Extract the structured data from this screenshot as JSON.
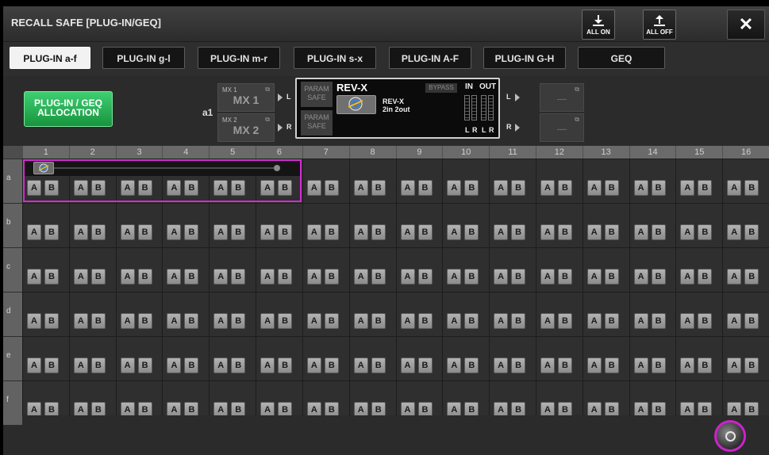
{
  "window": {
    "title": "RECALL SAFE [PLUG-IN/GEQ]"
  },
  "header": {
    "all_on_label": "ALL ON",
    "all_off_label": "ALL OFF",
    "close_glyph": "✕"
  },
  "tabs": [
    {
      "label": "PLUG-IN a-f",
      "active": true
    },
    {
      "label": "PLUG-IN g-l",
      "active": false
    },
    {
      "label": "PLUG-IN m-r",
      "active": false
    },
    {
      "label": "PLUG-IN s-x",
      "active": false
    },
    {
      "label": "PLUG-IN A-F",
      "active": false
    },
    {
      "label": "PLUG-IN G-H",
      "active": false
    },
    {
      "label": "GEQ",
      "active": false
    }
  ],
  "allocation_button": {
    "line1": "PLUG-IN / GEQ",
    "line2": "ALLOCATION"
  },
  "slot": {
    "label": "a1",
    "inputs": [
      {
        "small": "MX 1",
        "big": "MX 1",
        "side": "L"
      },
      {
        "small": "MX 2",
        "big": "MX 2",
        "side": "R"
      }
    ],
    "param_safe_top": "PARAM SAFE",
    "param_safe_bottom": "PARAM SAFE",
    "plugin_name": "REV-X",
    "plugin_icon": "REV-X",
    "plugin_model": "REV-X",
    "plugin_config": "2in 2out",
    "bypass": "BYPASS",
    "in_label": "IN",
    "out_label": "OUT",
    "meter_labels": [
      "L",
      "R",
      "L",
      "R"
    ],
    "outputs": [
      {
        "side": "L",
        "value": "----"
      },
      {
        "side": "R",
        "value": "----"
      }
    ]
  },
  "grid": {
    "columns": [
      "1",
      "2",
      "3",
      "4",
      "5",
      "6",
      "7",
      "8",
      "9",
      "10",
      "11",
      "12",
      "13",
      "14",
      "15",
      "16"
    ],
    "rows": [
      "a",
      "b",
      "c",
      "d",
      "e",
      "f"
    ],
    "button_a": "A",
    "button_b": "B",
    "selection_icon": "REV-X"
  },
  "colors": {
    "accent": "#d52bd5",
    "allocation_green": "#27b154"
  }
}
